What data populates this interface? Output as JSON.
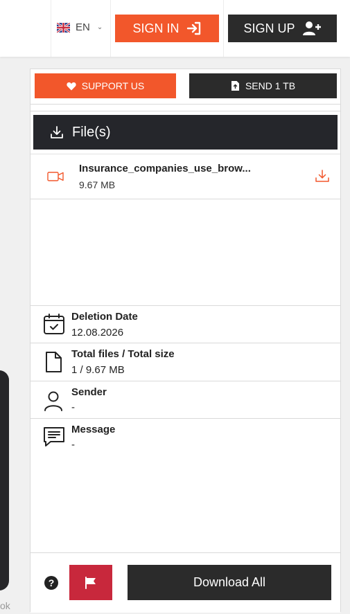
{
  "header": {
    "language": "EN",
    "signin_label": "SIGN IN",
    "signup_label": "SIGN UP"
  },
  "panel": {
    "support_label": "SUPPORT US",
    "send_label": "SEND 1 TB",
    "files_title": "File(s)",
    "file": {
      "name": "Insurance_companies_use_brow...",
      "size": "9.67 MB",
      "type_icon": "video-icon"
    },
    "info": {
      "deletion_label": "Deletion Date",
      "deletion_value": "12.08.2026",
      "total_label": "Total files / Total size",
      "total_value": "1 / 9.67 MB",
      "sender_label": "Sender",
      "sender_value": "-",
      "message_label": "Message",
      "message_value": "-"
    },
    "footer": {
      "help_label": "?",
      "download_all_label": "Download All"
    }
  },
  "left_fragment_text": "ok",
  "colors": {
    "accent": "#f2572b",
    "dark": "#2b2b2b",
    "report": "#c8283c"
  }
}
